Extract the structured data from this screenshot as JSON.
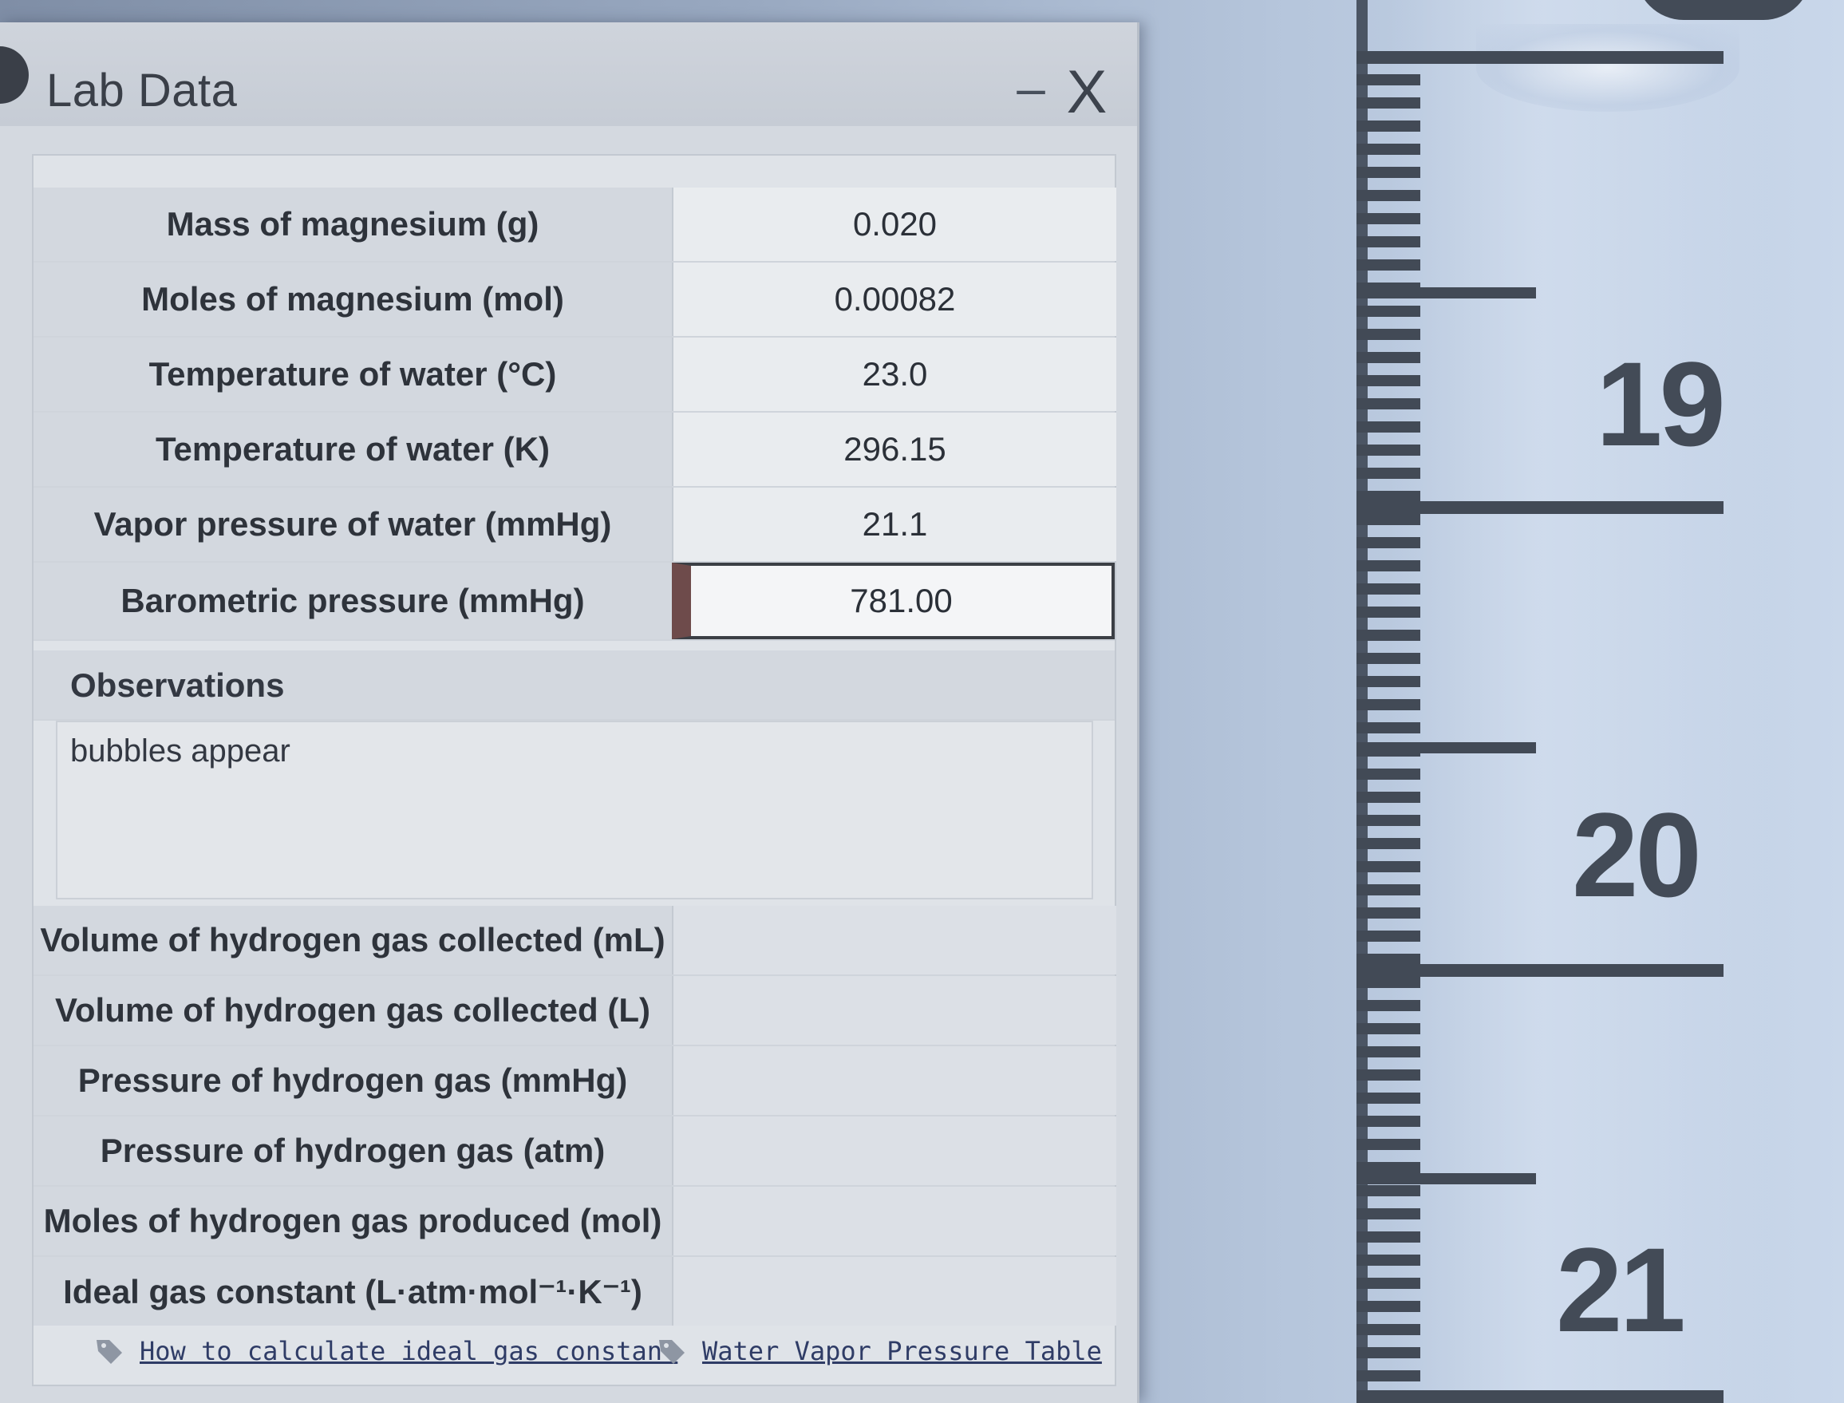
{
  "window": {
    "title": "Lab Data",
    "minimize_glyph": "–",
    "close_glyph": "X"
  },
  "rows": [
    {
      "label": "Mass of magnesium (g)",
      "value": "0.020"
    },
    {
      "label": "Moles of magnesium (mol)",
      "value": "0.00082"
    },
    {
      "label": "Temperature of water (°C)",
      "value": "23.0"
    },
    {
      "label": "Temperature of water (K)",
      "value": "296.15"
    },
    {
      "label": "Vapor pressure of water (mmHg)",
      "value": "21.1"
    },
    {
      "label": "Barometric pressure (mmHg)",
      "value": "781.00"
    }
  ],
  "observations": {
    "header": "Observations",
    "text": "bubbles appear"
  },
  "results": [
    {
      "label": "Volume of hydrogen gas collected (mL)",
      "value": ""
    },
    {
      "label": "Volume of hydrogen gas collected (L)",
      "value": ""
    },
    {
      "label": "Pressure of hydrogen gas (mmHg)",
      "value": ""
    },
    {
      "label": "Pressure of hydrogen gas (atm)",
      "value": ""
    },
    {
      "label": "Moles of hydrogen gas produced (mol)",
      "value": ""
    },
    {
      "label": "Ideal gas constant (L·atm·mol⁻¹·K⁻¹)",
      "value": ""
    }
  ],
  "links": {
    "ideal_gas": "How to calculate ideal gas constant",
    "vapor_table": "Water Vapor Pressure Table",
    "icon": "tag-icon"
  },
  "ruler": {
    "numbers": [
      "19",
      "20",
      "21"
    ]
  },
  "colors": {
    "panel": "#dfe3e8",
    "label_cell": "#d3d8df",
    "value_cell": "#e9ecef",
    "active_marker": "#6e4b4b",
    "link": "#2f3c66",
    "ruler_ink": "#434b57"
  }
}
